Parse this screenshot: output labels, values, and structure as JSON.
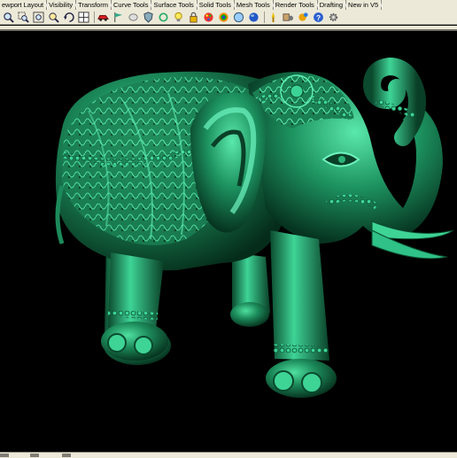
{
  "tabs": [
    "ewport Layout",
    "Visibility",
    "Transform",
    "Curve Tools",
    "Surface Tools",
    "Solid Tools",
    "Mesh Tools",
    "Render Tools",
    "Drafting",
    "New in V5"
  ],
  "toolbar": {
    "icons": [
      "zoom-icon",
      "zoom-window-icon",
      "zoom-extents-icon",
      "zoom-selected-icon",
      "undo-view-icon",
      "four-viewports-icon",
      "car-icon",
      "flag-icon",
      "ghost-icon",
      "shield-icon",
      "refresh-icon",
      "lightbulb-icon",
      "lock-icon",
      "palette-icon",
      "rainbow-icon",
      "sphere-icon",
      "mesh-icon",
      "render-sphere-icon",
      "light-cone-icon",
      "render-cog-icon",
      "help-icon",
      "gear-icon"
    ]
  },
  "viewport": {
    "model_color": "#1c8a5a",
    "background": "#000000"
  }
}
